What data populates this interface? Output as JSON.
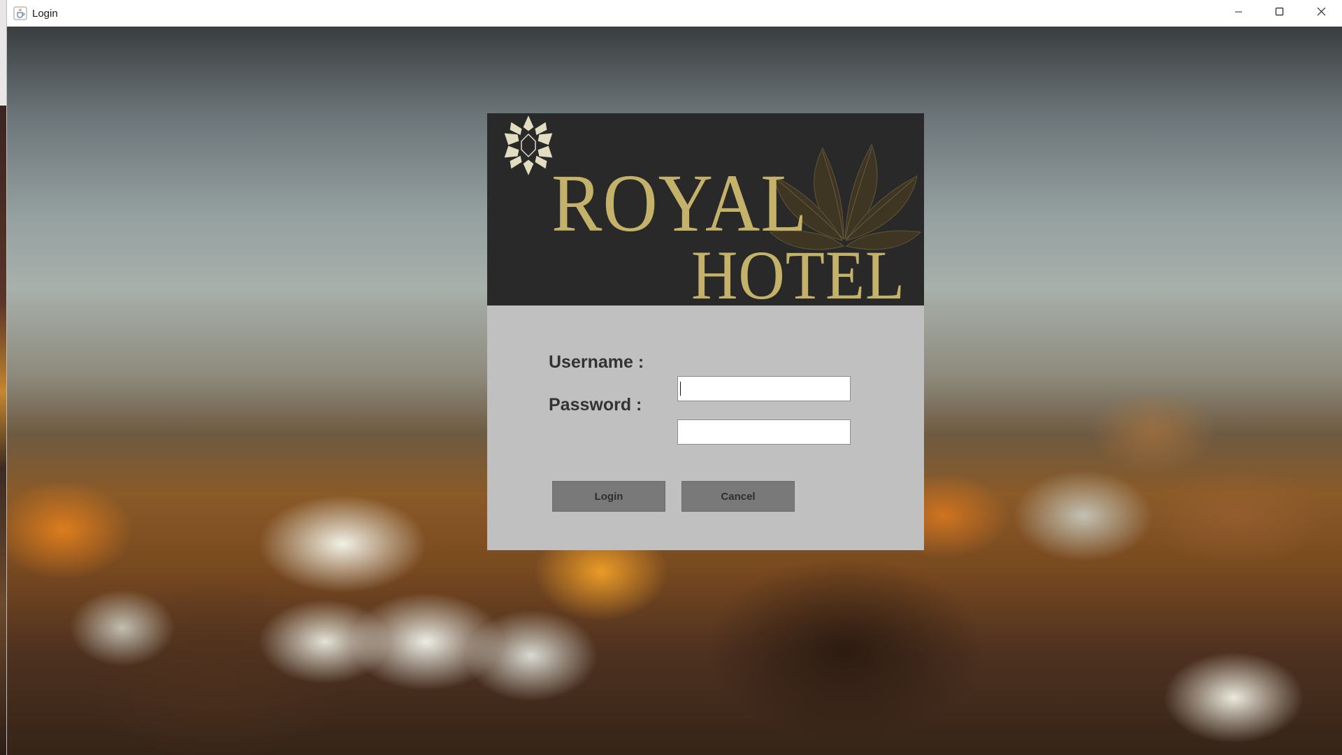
{
  "window": {
    "title": "Login",
    "icon": "java-cup-icon",
    "controls": [
      "minimize-icon",
      "maximize-icon",
      "close-icon"
    ]
  },
  "banner": {
    "brand_line1": "ROYAL",
    "brand_line2": "HOTEL",
    "emblem": "star-emblem-icon",
    "decoration": "lotus-icon"
  },
  "form": {
    "username_label": "Username :",
    "username_value": "",
    "password_label": "Password  :",
    "password_value": ""
  },
  "buttons": {
    "login_label": "Login",
    "cancel_label": "Cancel"
  },
  "colors": {
    "banner_bg": "#292929",
    "brand_gold": "#c4b26a",
    "panel_bg": "#c0c0c0",
    "button_bg": "#797979"
  }
}
